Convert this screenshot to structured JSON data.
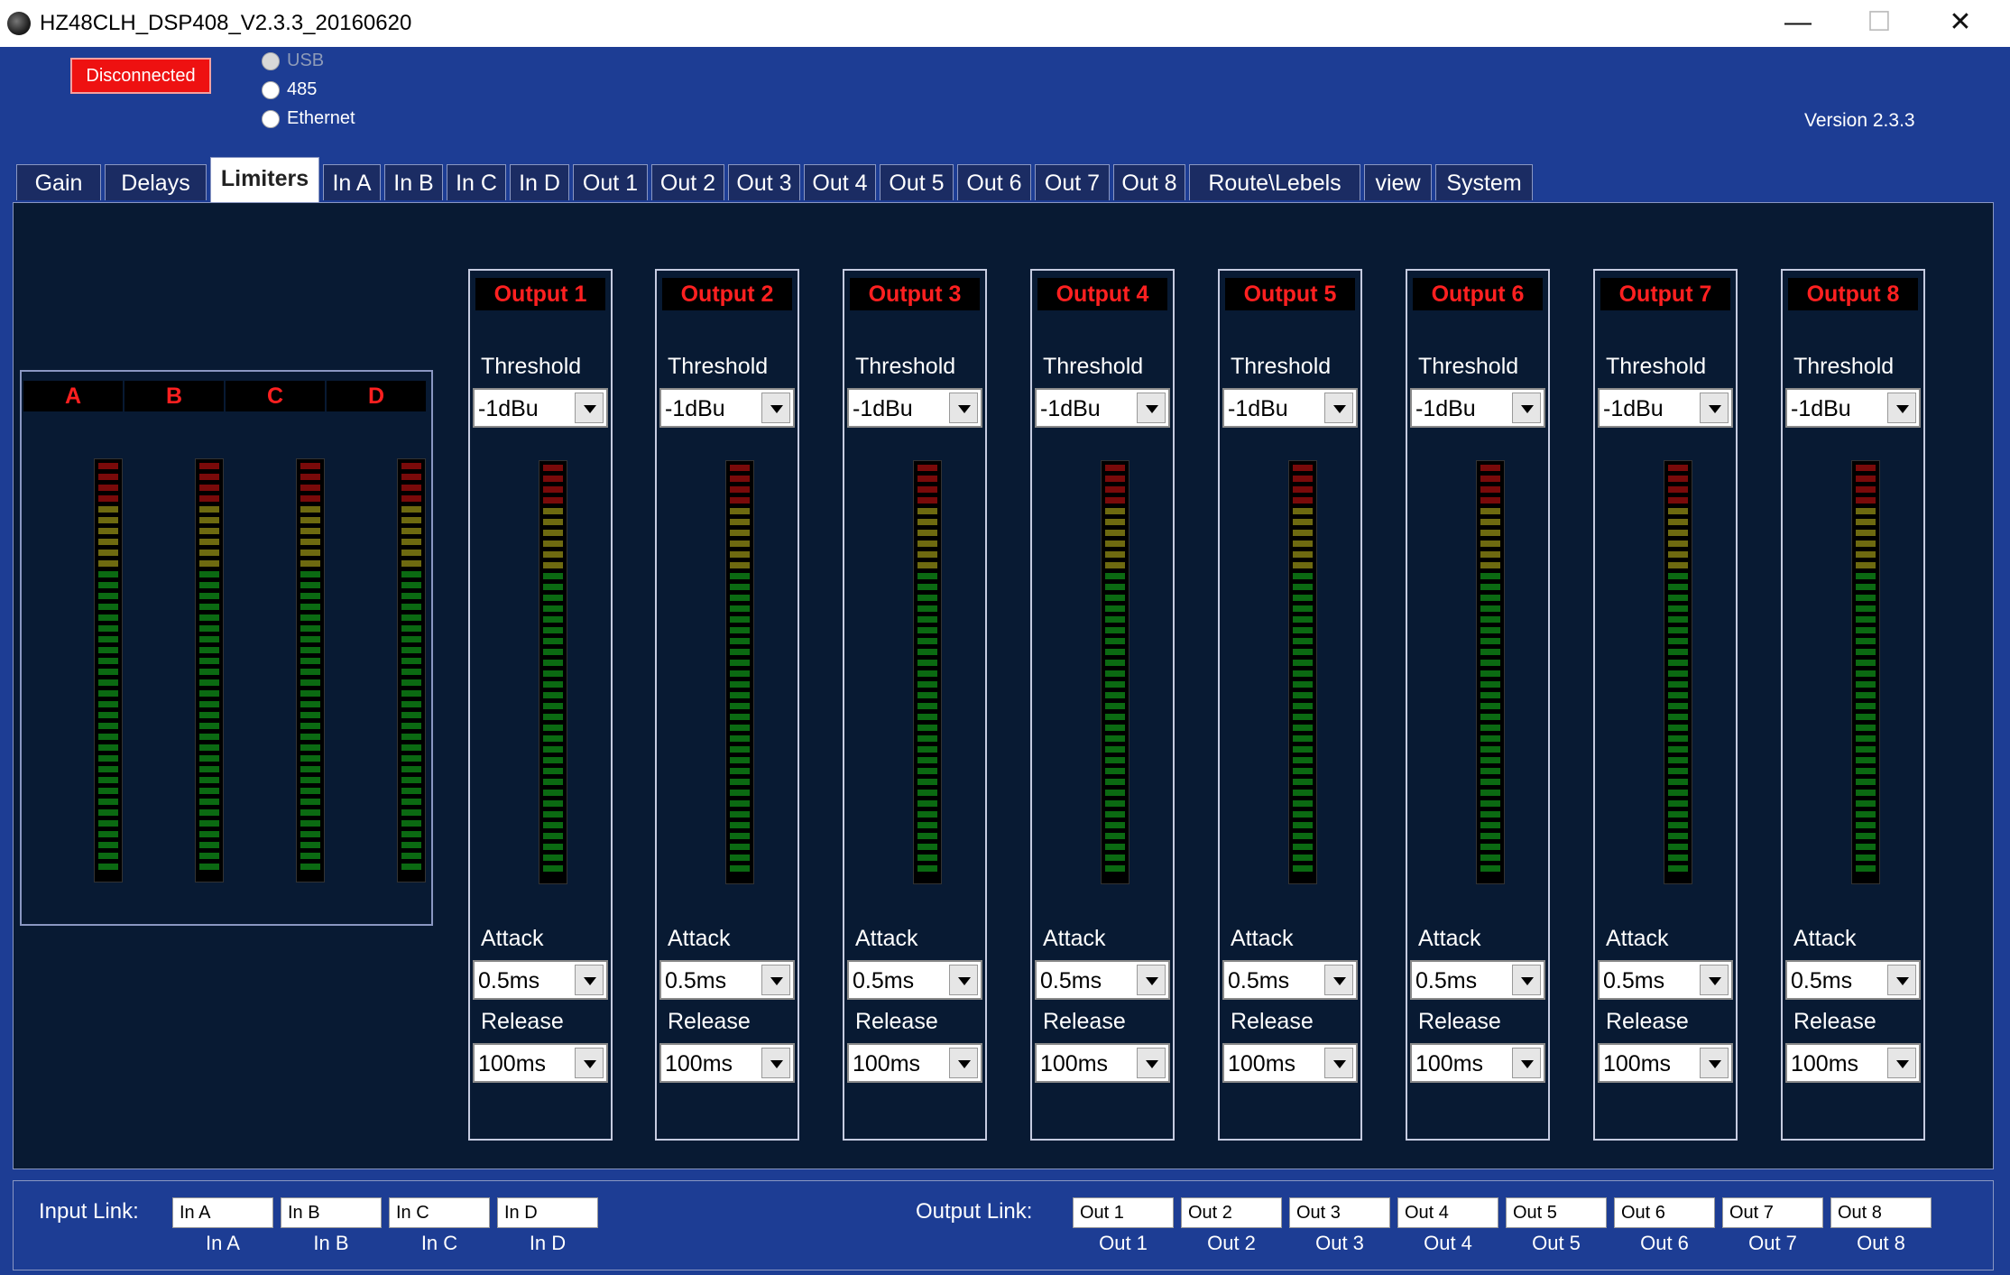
{
  "window": {
    "title": "HZ48CLH_DSP408_V2.3.3_20160620",
    "minimize": "—",
    "maximize": "☐",
    "close": "✕"
  },
  "connection": {
    "status": "Disconnected",
    "status_color": "#ee1111"
  },
  "interfaces": [
    {
      "label": "USB",
      "enabled": false
    },
    {
      "label": "485",
      "enabled": true
    },
    {
      "label": "Ethernet",
      "enabled": true
    }
  ],
  "version": "Version 2.3.3",
  "tabs": [
    "Gain",
    "Delays",
    "Limiters",
    "In A",
    "In B",
    "In C",
    "In D",
    "Out 1",
    "Out 2",
    "Out 3",
    "Out 4",
    "Out 5",
    "Out 6",
    "Out 7",
    "Out 8",
    "Route\\Lebels",
    "view",
    "System"
  ],
  "active_tab": "Limiters",
  "inputs": [
    "A",
    "B",
    "C",
    "D"
  ],
  "outputs": [
    {
      "name": "Output 1",
      "threshold_label": "Threshold",
      "threshold": "-1dBu",
      "attack_label": "Attack",
      "attack": "0.5ms",
      "release_label": "Release",
      "release": "100ms"
    },
    {
      "name": "Output 2",
      "threshold_label": "Threshold",
      "threshold": "-1dBu",
      "attack_label": "Attack",
      "attack": "0.5ms",
      "release_label": "Release",
      "release": "100ms"
    },
    {
      "name": "Output 3",
      "threshold_label": "Threshold",
      "threshold": "-1dBu",
      "attack_label": "Attack",
      "attack": "0.5ms",
      "release_label": "Release",
      "release": "100ms"
    },
    {
      "name": "Output 4",
      "threshold_label": "Threshold",
      "threshold": "-1dBu",
      "attack_label": "Attack",
      "attack": "0.5ms",
      "release_label": "Release",
      "release": "100ms"
    },
    {
      "name": "Output 5",
      "threshold_label": "Threshold",
      "threshold": "-1dBu",
      "attack_label": "Attack",
      "attack": "0.5ms",
      "release_label": "Release",
      "release": "100ms"
    },
    {
      "name": "Output 6",
      "threshold_label": "Threshold",
      "threshold": "-1dBu",
      "attack_label": "Attack",
      "attack": "0.5ms",
      "release_label": "Release",
      "release": "100ms"
    },
    {
      "name": "Output 7",
      "threshold_label": "Threshold",
      "threshold": "-1dBu",
      "attack_label": "Attack",
      "attack": "0.5ms",
      "release_label": "Release",
      "release": "100ms"
    },
    {
      "name": "Output 8",
      "threshold_label": "Threshold",
      "threshold": "-1dBu",
      "attack_label": "Attack",
      "attack": "0.5ms",
      "release_label": "Release",
      "release": "100ms"
    }
  ],
  "meter_level": 0,
  "colors": {
    "meter_red": "#7a0a0a",
    "meter_yellow": "#6e6a10",
    "meter_green": "#0b6a12",
    "label_red": "#ff2020"
  },
  "input_link": {
    "label": "Input Link:",
    "boxes": [
      "In A",
      "In B",
      "In C",
      "In D"
    ],
    "subs": [
      "In A",
      "In B",
      "In C",
      "In D"
    ]
  },
  "output_link": {
    "label": "Output Link:",
    "boxes": [
      "Out 1",
      "Out 2",
      "Out 3",
      "Out 4",
      "Out 5",
      "Out 6",
      "Out 7",
      "Out 8"
    ],
    "subs": [
      "Out 1",
      "Out 2",
      "Out 3",
      "Out 4",
      "Out 5",
      "Out 6",
      "Out 7",
      "Out 8"
    ]
  }
}
